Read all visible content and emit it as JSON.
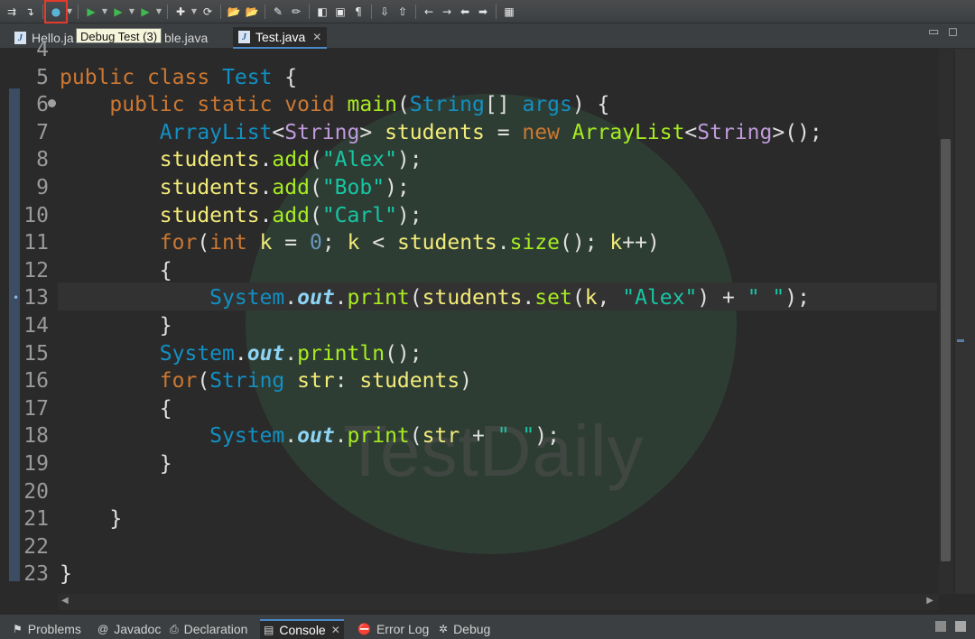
{
  "toolbar": {
    "buttons": [
      {
        "icon": "skip-breakpoints-icon",
        "glyph": "⇉"
      },
      {
        "icon": "step-icon",
        "glyph": "↴"
      },
      {
        "icon": "debug-icon",
        "glyph": "●",
        "highlighted": true
      },
      {
        "icon": "run-icon",
        "glyph": "▶"
      },
      {
        "icon": "coverage-icon",
        "glyph": "▶"
      },
      {
        "icon": "external-tools-icon",
        "glyph": "▶"
      },
      {
        "icon": "new-class-icon",
        "glyph": "✚"
      },
      {
        "icon": "refresh-icon",
        "glyph": "⟳"
      },
      {
        "icon": "open-folder-icon",
        "glyph": "📂"
      },
      {
        "icon": "open-task-icon",
        "glyph": "📂"
      },
      {
        "icon": "pen-icon",
        "glyph": "✎"
      },
      {
        "icon": "annotation-icon",
        "glyph": "✏"
      },
      {
        "icon": "toggle-mark-icon",
        "glyph": "◧"
      },
      {
        "icon": "block-selection-icon",
        "glyph": "▣"
      },
      {
        "icon": "show-whitespace-icon",
        "glyph": "¶"
      },
      {
        "icon": "next-annotation-icon",
        "glyph": "⇩"
      },
      {
        "icon": "prev-annotation-icon",
        "glyph": "⇧"
      },
      {
        "icon": "back-icon",
        "glyph": "←"
      },
      {
        "icon": "forward-icon",
        "glyph": "→"
      },
      {
        "icon": "last-edit-icon",
        "glyph": "⬅"
      },
      {
        "icon": "nav-forward-icon",
        "glyph": "➡"
      },
      {
        "icon": "pin-editor-icon",
        "glyph": "▦"
      }
    ]
  },
  "tooltip": "Debug Test (3)",
  "tabs": [
    {
      "label": "Hello.ja",
      "active": false
    },
    {
      "label": "ble.java",
      "active": false
    },
    {
      "label": "Test.java",
      "active": true
    }
  ],
  "editor": {
    "watermark": "TestDaily",
    "lines": [
      {
        "num": "4",
        "tokens": []
      },
      {
        "num": "5",
        "tokens": [
          [
            "kw",
            "public"
          ],
          [
            "plain",
            " "
          ],
          [
            "kw",
            "class"
          ],
          [
            "plain",
            " "
          ],
          [
            "type",
            "Test"
          ],
          [
            "plain",
            " {"
          ]
        ]
      },
      {
        "num": "6",
        "fold": true,
        "tokens": [
          [
            "plain",
            "    "
          ],
          [
            "kw",
            "public"
          ],
          [
            "plain",
            " "
          ],
          [
            "kw",
            "static"
          ],
          [
            "plain",
            " "
          ],
          [
            "kw",
            "void"
          ],
          [
            "plain",
            " "
          ],
          [
            "method",
            "main"
          ],
          [
            "plain",
            "("
          ],
          [
            "type",
            "String"
          ],
          [
            "plain",
            "[] "
          ],
          [
            "type",
            "args"
          ],
          [
            "plain",
            ") {"
          ]
        ]
      },
      {
        "num": "7",
        "tokens": [
          [
            "plain",
            "        "
          ],
          [
            "type",
            "ArrayList"
          ],
          [
            "plain",
            "<"
          ],
          [
            "generic",
            "String"
          ],
          [
            "plain",
            "> "
          ],
          [
            "var",
            "students"
          ],
          [
            "plain",
            " = "
          ],
          [
            "kw",
            "new"
          ],
          [
            "plain",
            " "
          ],
          [
            "method",
            "ArrayList"
          ],
          [
            "plain",
            "<"
          ],
          [
            "generic",
            "String"
          ],
          [
            "plain",
            ">();"
          ]
        ]
      },
      {
        "num": "8",
        "tokens": [
          [
            "plain",
            "        "
          ],
          [
            "var",
            "students"
          ],
          [
            "plain",
            "."
          ],
          [
            "method",
            "add"
          ],
          [
            "plain",
            "("
          ],
          [
            "str",
            "\"Alex\""
          ],
          [
            "plain",
            ");"
          ]
        ]
      },
      {
        "num": "9",
        "tokens": [
          [
            "plain",
            "        "
          ],
          [
            "var",
            "students"
          ],
          [
            "plain",
            "."
          ],
          [
            "method",
            "add"
          ],
          [
            "plain",
            "("
          ],
          [
            "str",
            "\"Bob\""
          ],
          [
            "plain",
            ");"
          ]
        ]
      },
      {
        "num": "10",
        "tokens": [
          [
            "plain",
            "        "
          ],
          [
            "var",
            "students"
          ],
          [
            "plain",
            "."
          ],
          [
            "method",
            "add"
          ],
          [
            "plain",
            "("
          ],
          [
            "str",
            "\"Carl\""
          ],
          [
            "plain",
            ");"
          ]
        ]
      },
      {
        "num": "11",
        "tokens": [
          [
            "plain",
            "        "
          ],
          [
            "kw",
            "for"
          ],
          [
            "plain",
            "("
          ],
          [
            "kw",
            "int"
          ],
          [
            "plain",
            " "
          ],
          [
            "var",
            "k"
          ],
          [
            "plain",
            " = "
          ],
          [
            "num",
            "0"
          ],
          [
            "plain",
            "; "
          ],
          [
            "var",
            "k"
          ],
          [
            "plain",
            " < "
          ],
          [
            "var",
            "students"
          ],
          [
            "plain",
            "."
          ],
          [
            "method",
            "size"
          ],
          [
            "plain",
            "(); "
          ],
          [
            "var",
            "k"
          ],
          [
            "plain",
            "++)"
          ]
        ]
      },
      {
        "num": "12",
        "tokens": [
          [
            "plain",
            "        {"
          ]
        ]
      },
      {
        "num": "13",
        "current": true,
        "marker": true,
        "tokens": [
          [
            "plain",
            "            "
          ],
          [
            "type",
            "System"
          ],
          [
            "plain",
            "."
          ],
          [
            "field",
            "out"
          ],
          [
            "plain",
            "."
          ],
          [
            "method",
            "print"
          ],
          [
            "plain",
            "("
          ],
          [
            "var",
            "students"
          ],
          [
            "plain",
            "."
          ],
          [
            "method",
            "set"
          ],
          [
            "plain",
            "("
          ],
          [
            "var",
            "k"
          ],
          [
            "plain",
            ", "
          ],
          [
            "str",
            "\"Alex\""
          ],
          [
            "plain",
            ") + "
          ],
          [
            "str",
            "\" \""
          ],
          [
            "plain",
            ");"
          ]
        ]
      },
      {
        "num": "14",
        "tokens": [
          [
            "plain",
            "        }"
          ]
        ]
      },
      {
        "num": "15",
        "tokens": [
          [
            "plain",
            "        "
          ],
          [
            "type",
            "System"
          ],
          [
            "plain",
            "."
          ],
          [
            "field",
            "out"
          ],
          [
            "plain",
            "."
          ],
          [
            "method",
            "println"
          ],
          [
            "plain",
            "();"
          ]
        ]
      },
      {
        "num": "16",
        "tokens": [
          [
            "plain",
            "        "
          ],
          [
            "kw",
            "for"
          ],
          [
            "plain",
            "("
          ],
          [
            "type",
            "String"
          ],
          [
            "plain",
            " "
          ],
          [
            "var",
            "str"
          ],
          [
            "plain",
            ": "
          ],
          [
            "var",
            "students"
          ],
          [
            "plain",
            ")"
          ]
        ]
      },
      {
        "num": "17",
        "tokens": [
          [
            "plain",
            "        {"
          ]
        ]
      },
      {
        "num": "18",
        "tokens": [
          [
            "plain",
            "            "
          ],
          [
            "type",
            "System"
          ],
          [
            "plain",
            "."
          ],
          [
            "field",
            "out"
          ],
          [
            "plain",
            "."
          ],
          [
            "method",
            "print"
          ],
          [
            "plain",
            "("
          ],
          [
            "var",
            "str"
          ],
          [
            "plain",
            " + "
          ],
          [
            "str",
            "\" \""
          ],
          [
            "plain",
            ");"
          ]
        ]
      },
      {
        "num": "19",
        "tokens": [
          [
            "plain",
            "        }"
          ]
        ]
      },
      {
        "num": "20",
        "tokens": []
      },
      {
        "num": "21",
        "tokens": [
          [
            "plain",
            "    }"
          ]
        ]
      },
      {
        "num": "22",
        "tokens": []
      },
      {
        "num": "23",
        "tokens": [
          [
            "plain",
            "}"
          ]
        ]
      }
    ]
  },
  "bottom_tabs": [
    {
      "label": "Problems",
      "icon": "problems-icon",
      "glyph": "⚑",
      "active": false
    },
    {
      "label": "Javadoc",
      "icon": "javadoc-icon",
      "glyph": "@",
      "active": false
    },
    {
      "label": "Declaration",
      "icon": "declaration-icon",
      "glyph": "⎙",
      "active": false
    },
    {
      "label": "Console",
      "icon": "console-icon",
      "glyph": "▤",
      "active": true
    },
    {
      "label": "Error Log",
      "icon": "error-log-icon",
      "glyph": "⛔",
      "active": false
    },
    {
      "label": "Debug",
      "icon": "debug-view-icon",
      "glyph": "✲",
      "active": false
    }
  ]
}
